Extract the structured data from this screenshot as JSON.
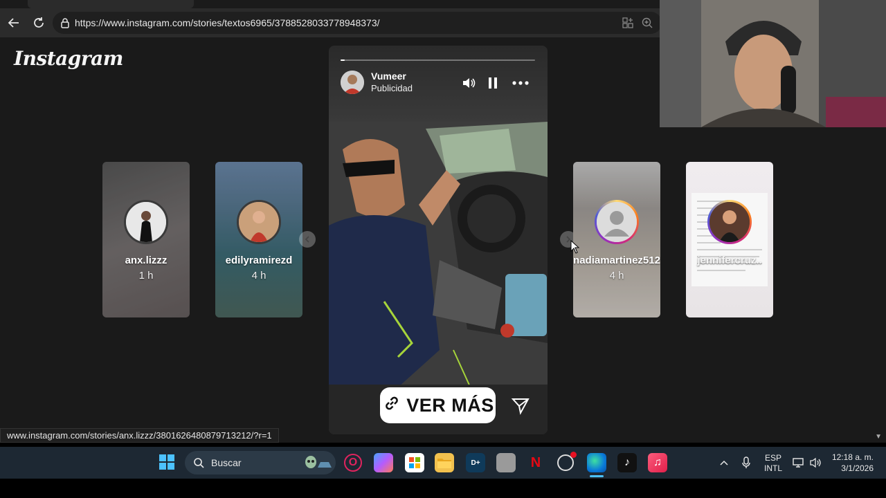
{
  "browser": {
    "url": "https://www.instagram.com/stories/textos6965/3788528033778948373/",
    "status_url": "www.instagram.com/stories/anx.lizzz/3801626480879713212/?r=1"
  },
  "instagram": {
    "logo_text": "Instagram",
    "story": {
      "author": "Vumeer",
      "sponsored_label": "Publicidad",
      "cta_label": "VER MÁS",
      "progress": 0.02
    },
    "left_stories": [
      {
        "username": "anx.lizzz",
        "time": "1 h"
      },
      {
        "username": "edilyramirezd",
        "time": "4 h"
      }
    ],
    "right_stories": [
      {
        "username": "nadiamartinez512",
        "time": "4 h"
      },
      {
        "username": "jennifercruz..",
        "time": ""
      }
    ]
  },
  "taskbar": {
    "search_placeholder": "Buscar",
    "language_line1": "ESP",
    "language_line2": "INTL",
    "time": "12:18 a. m.",
    "date": "3/1/2026"
  },
  "colors": {
    "page_bg": "#1a1a1a",
    "taskbar_bg": "#1d2833",
    "ig_gradient": [
      "#feda75",
      "#fa7e1e",
      "#d62976",
      "#962fbf",
      "#4f5bd5"
    ]
  }
}
